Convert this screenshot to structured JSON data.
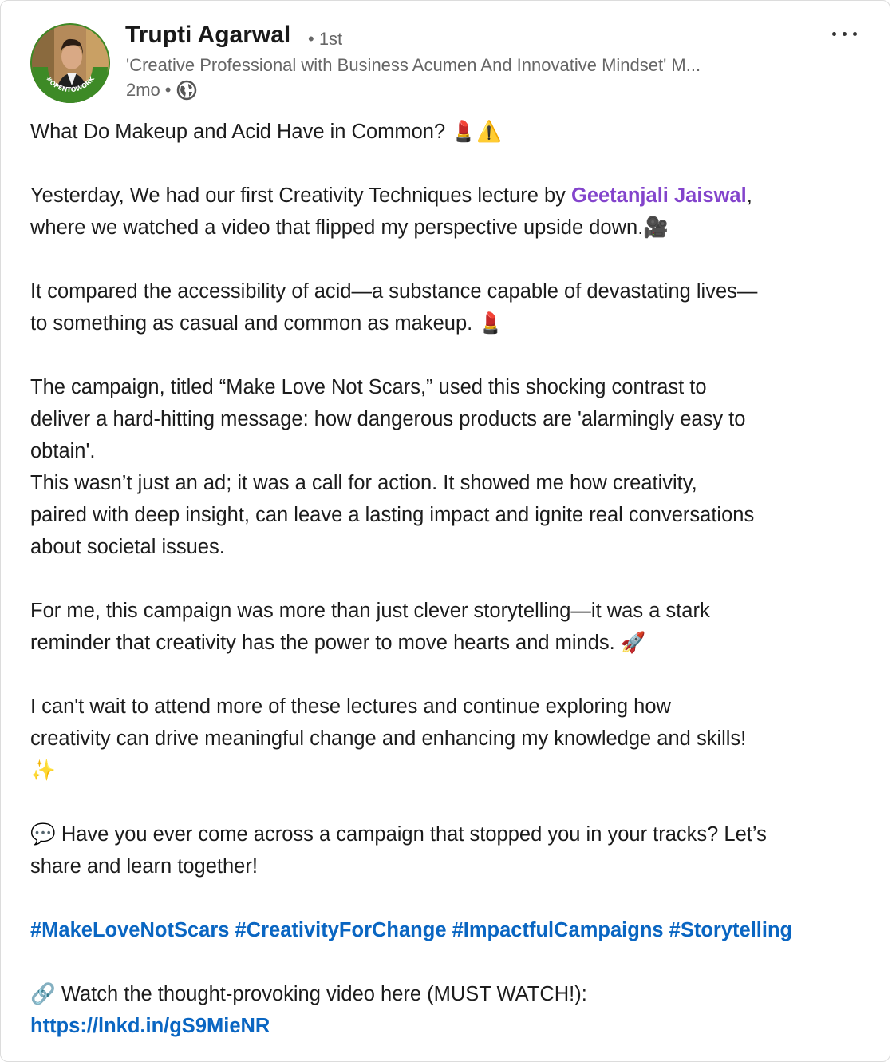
{
  "author": {
    "name": "Trupti Agarwal",
    "degree": "• 1st",
    "headline": "'Creative Professional with Business Acumen And Innovative Mindset' M...",
    "time": "2mo",
    "separator": "•",
    "badge": "#OPENTOWORK",
    "visibility_icon": "globe-icon"
  },
  "menu": {
    "icon": "more-options-icon"
  },
  "post": {
    "line1": "What Do Makeup and Acid Have in Common? 💄⚠️",
    "line2a": "Yesterday, We had our first Creativity Techniques lecture by ",
    "mention": "Geetanjali Jaiswal",
    "line2b": ",",
    "line3": "where we watched a video that flipped my perspective upside down.🎥",
    "line4": "It compared the accessibility of acid—a substance capable of devastating lives—",
    "line5": "to something as casual and common as makeup. 💄",
    "line6": "The campaign, titled “Make Love Not Scars,” used this shocking contrast to",
    "line7": "deliver a hard-hitting message: how dangerous products are 'alarmingly easy to",
    "line8": "obtain'.",
    "line9": "This wasn’t just an ad; it was a call for action. It showed me how creativity,",
    "line10": "paired with deep insight, can leave a lasting impact and ignite real conversations",
    "line11": "about societal issues.",
    "line12": "For me, this campaign was more than just clever storytelling—it was a stark",
    "line13": "reminder that creativity has the power to move hearts and minds. 🚀",
    "line14": "I can't wait to attend more of these lectures and continue exploring how",
    "line15": "creativity can drive meaningful change and enhancing my knowledge and skills!",
    "line16": "✨",
    "line17": "💬 Have you ever come across a campaign that stopped you in your tracks? Let’s",
    "line18": "share and learn together!",
    "hashtags": "#MakeLoveNotScars #CreativityForChange #ImpactfulCampaigns #Storytelling",
    "line19": "🔗 Watch the thought-provoking video here (MUST WATCH!):",
    "url": "https://lnkd.in/gS9MieNR"
  }
}
